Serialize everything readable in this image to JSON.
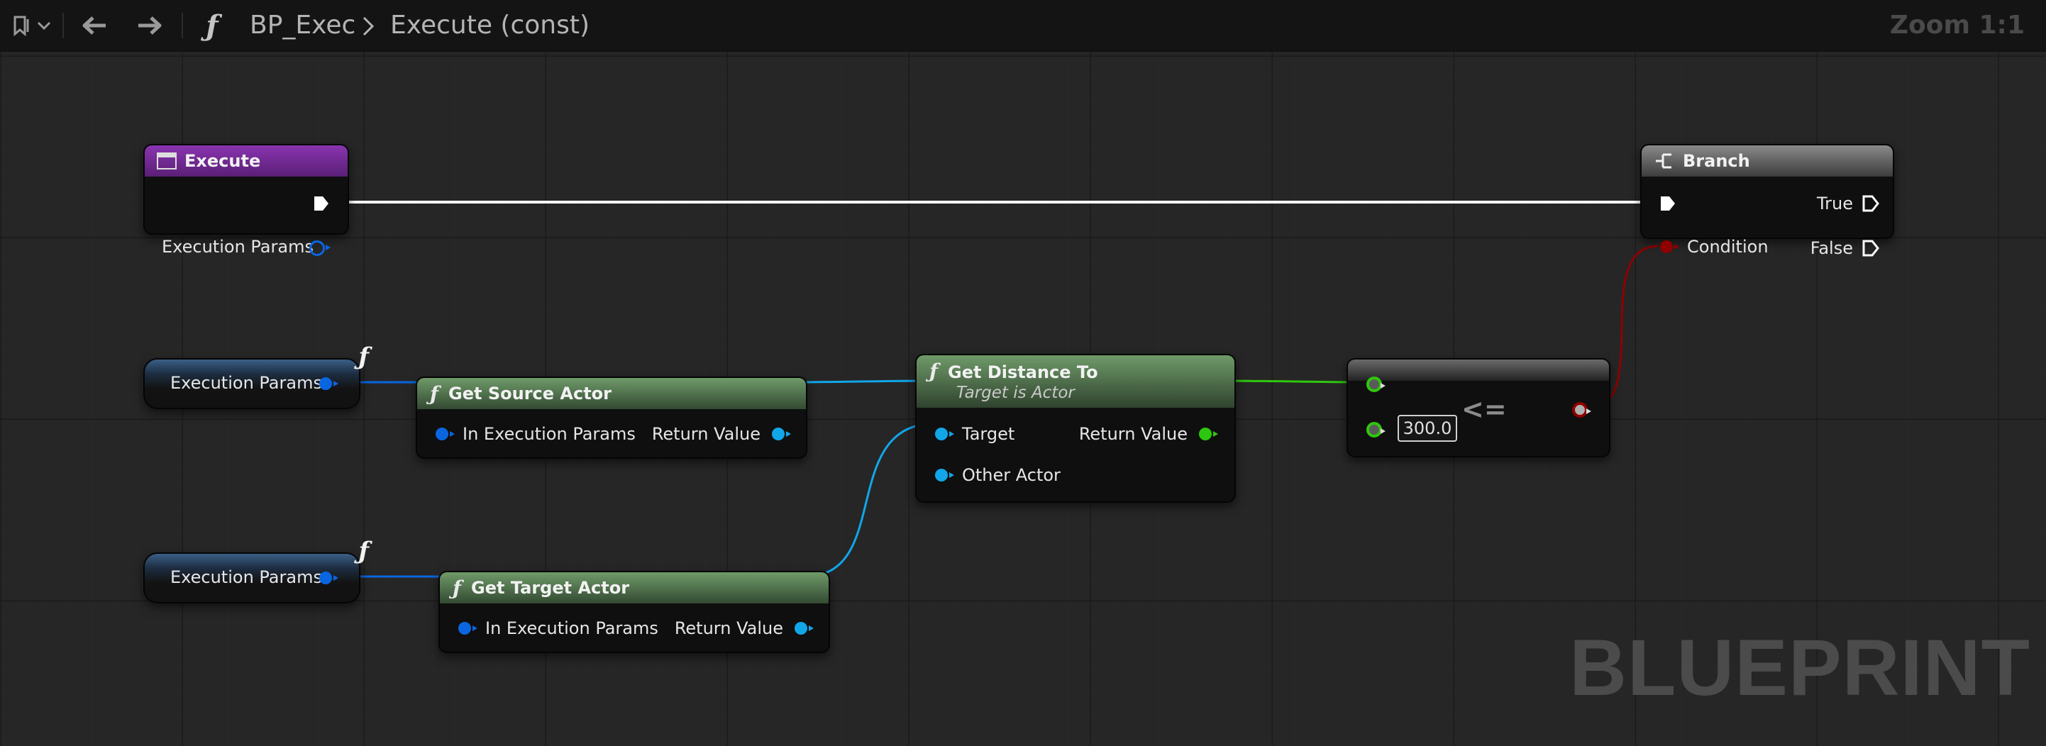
{
  "toolbar": {
    "breadcrumb_blueprint": "BP_Exec",
    "breadcrumb_function": "Execute (const)",
    "zoom": "Zoom 1:1"
  },
  "nodes": {
    "execute": {
      "title": "Execute",
      "param": "Execution Params"
    },
    "branch": {
      "title": "Branch",
      "true_label": "True",
      "false_label": "False",
      "condition_label": "Condition"
    },
    "get_source": {
      "title": "Get Source Actor",
      "input": "In Execution Params",
      "output": "Return Value"
    },
    "get_target": {
      "title": "Get Target Actor",
      "input": "In Execution Params",
      "output": "Return Value"
    },
    "get_distance": {
      "title": "Get Distance To",
      "subtitle": "Target is Actor",
      "target": "Target",
      "other": "Other Actor",
      "output": "Return Value"
    },
    "compare": {
      "operator": "<=",
      "value": "300.0"
    },
    "var_source": {
      "label": "Execution Params"
    },
    "var_target": {
      "label": "Execution Params"
    }
  },
  "watermark": "BLUEPRINT",
  "colors": {
    "exec_wire": "#ffffff",
    "struct_wire": "#0a66e0",
    "object_wire": "#11a6e8",
    "float_wire": "#2ec70f",
    "bool_wire": "#8f0000",
    "function_header": "#4e6e4b",
    "event_header": "#7a2a9c",
    "branch_header": "#5e5e5e"
  },
  "icons": [
    "bookmark-icon",
    "chevron-down-icon",
    "back-arrow-icon",
    "forward-arrow-icon",
    "function-icon",
    "breadcrumb-chevron-icon",
    "event-icon",
    "branch-icon"
  ]
}
